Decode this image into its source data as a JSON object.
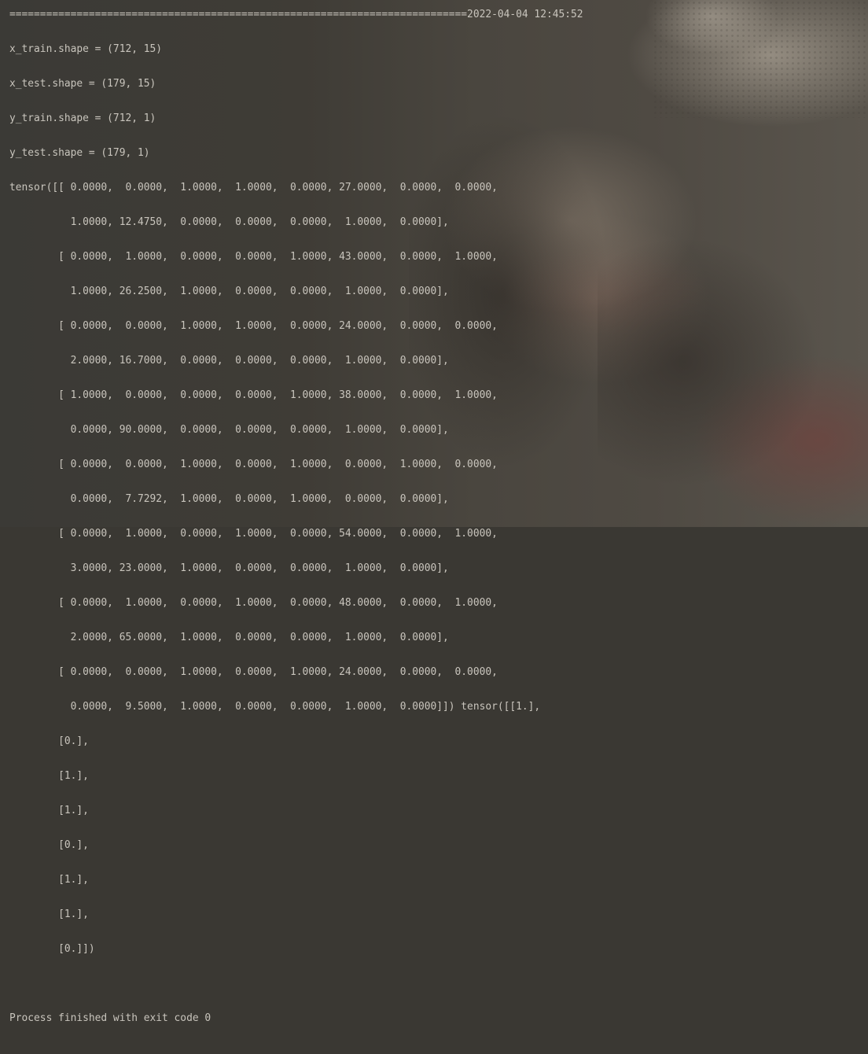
{
  "console": {
    "lines": [
      "===========================================================================2022-04-04 12:45:52",
      "x_train.shape = (712, 15)",
      "x_test.shape = (179, 15)",
      "y_train.shape = (712, 1)",
      "y_test.shape = (179, 1)",
      "tensor([[ 0.0000,  0.0000,  1.0000,  1.0000,  0.0000, 27.0000,  0.0000,  0.0000,",
      "          1.0000, 12.4750,  0.0000,  0.0000,  0.0000,  1.0000,  0.0000],",
      "        [ 0.0000,  1.0000,  0.0000,  0.0000,  1.0000, 43.0000,  0.0000,  1.0000,",
      "          1.0000, 26.2500,  1.0000,  0.0000,  0.0000,  1.0000,  0.0000],",
      "        [ 0.0000,  0.0000,  1.0000,  1.0000,  0.0000, 24.0000,  0.0000,  0.0000,",
      "          2.0000, 16.7000,  0.0000,  0.0000,  0.0000,  1.0000,  0.0000],",
      "        [ 1.0000,  0.0000,  0.0000,  0.0000,  1.0000, 38.0000,  0.0000,  1.0000,",
      "          0.0000, 90.0000,  0.0000,  0.0000,  0.0000,  1.0000,  0.0000],",
      "        [ 0.0000,  0.0000,  1.0000,  0.0000,  1.0000,  0.0000,  1.0000,  0.0000,",
      "          0.0000,  7.7292,  1.0000,  0.0000,  1.0000,  0.0000,  0.0000],",
      "        [ 0.0000,  1.0000,  0.0000,  1.0000,  0.0000, 54.0000,  0.0000,  1.0000,",
      "          3.0000, 23.0000,  1.0000,  0.0000,  0.0000,  1.0000,  0.0000],",
      "        [ 0.0000,  1.0000,  0.0000,  1.0000,  0.0000, 48.0000,  0.0000,  1.0000,",
      "          2.0000, 65.0000,  1.0000,  0.0000,  0.0000,  1.0000,  0.0000],",
      "        [ 0.0000,  0.0000,  1.0000,  0.0000,  1.0000, 24.0000,  0.0000,  0.0000,",
      "          0.0000,  9.5000,  1.0000,  0.0000,  0.0000,  1.0000,  0.0000]]) tensor([[1.],",
      "        [0.],",
      "        [1.],",
      "        [1.],",
      "        [0.],",
      "        [1.],",
      "        [1.],",
      "        [0.]])",
      "",
      "Process finished with exit code 0"
    ]
  },
  "colors": {
    "text": "#c9c5bd"
  }
}
